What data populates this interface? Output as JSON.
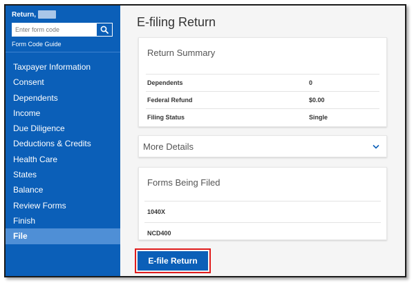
{
  "sidebar": {
    "return_title": "Return,",
    "search": {
      "placeholder": "Enter form code",
      "value": ""
    },
    "form_code_guide": "Form Code Guide",
    "items": [
      {
        "label": "Taxpayer Information",
        "active": false
      },
      {
        "label": "Consent",
        "active": false
      },
      {
        "label": "Dependents",
        "active": false
      },
      {
        "label": "Income",
        "active": false
      },
      {
        "label": "Due Diligence",
        "active": false
      },
      {
        "label": "Deductions & Credits",
        "active": false
      },
      {
        "label": "Health Care",
        "active": false
      },
      {
        "label": "States",
        "active": false
      },
      {
        "label": "Balance",
        "active": false
      },
      {
        "label": "Review Forms",
        "active": false
      },
      {
        "label": "Finish",
        "active": false
      },
      {
        "label": "File",
        "active": true
      }
    ]
  },
  "main": {
    "title": "E-filing Return",
    "summary": {
      "title": "Return Summary",
      "rows": [
        {
          "label": "Dependents",
          "value": "0"
        },
        {
          "label": "Federal Refund",
          "value": "$0.00"
        },
        {
          "label": "Filing Status",
          "value": "Single"
        }
      ]
    },
    "more_details": "More Details",
    "forms": {
      "title": "Forms Being Filed",
      "items": [
        "1040X",
        "NCD400"
      ]
    },
    "efile_button": "E-file Return"
  },
  "colors": {
    "sidebar_bg": "#0b5fb8",
    "sidebar_active": "#4f8fd6",
    "button_bg": "#0b5fb8",
    "highlight_border": "#e01b1b"
  },
  "icons": {
    "search": "search-icon",
    "chevron": "chevron-down-icon"
  }
}
